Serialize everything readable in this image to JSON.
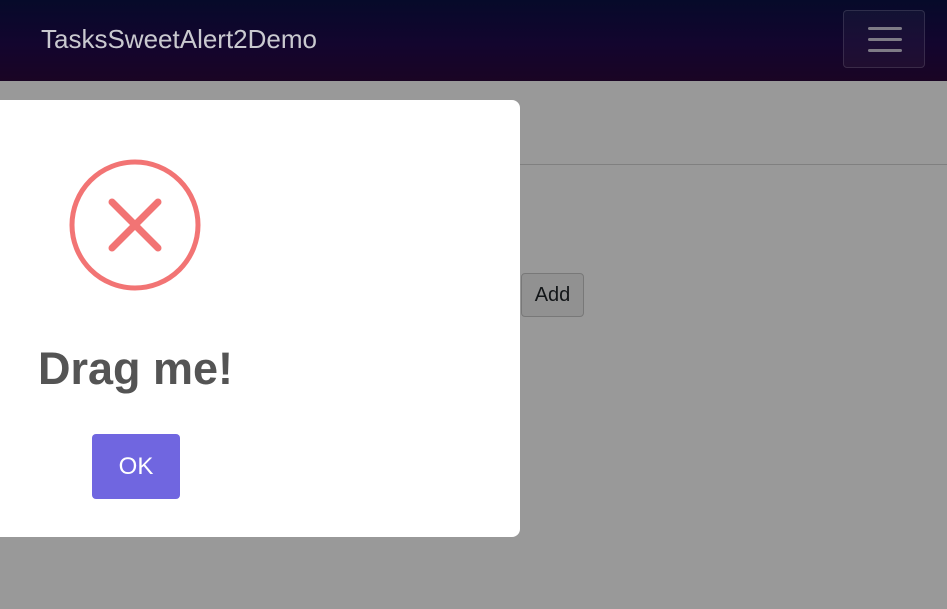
{
  "navbar": {
    "brand": "TasksSweetAlert2Demo",
    "menu_icon": "hamburger-menu-icon"
  },
  "page": {
    "add_label": "Add"
  },
  "modal": {
    "icon": "error-x-icon",
    "title": "Drag me!",
    "confirm_label": "OK"
  },
  "colors": {
    "navbar_background": "#0e0628",
    "error_icon": "#f27474",
    "confirm_button": "#7066e0",
    "title_text": "#545454",
    "overlay": "rgba(0,0,0,0.4)"
  }
}
